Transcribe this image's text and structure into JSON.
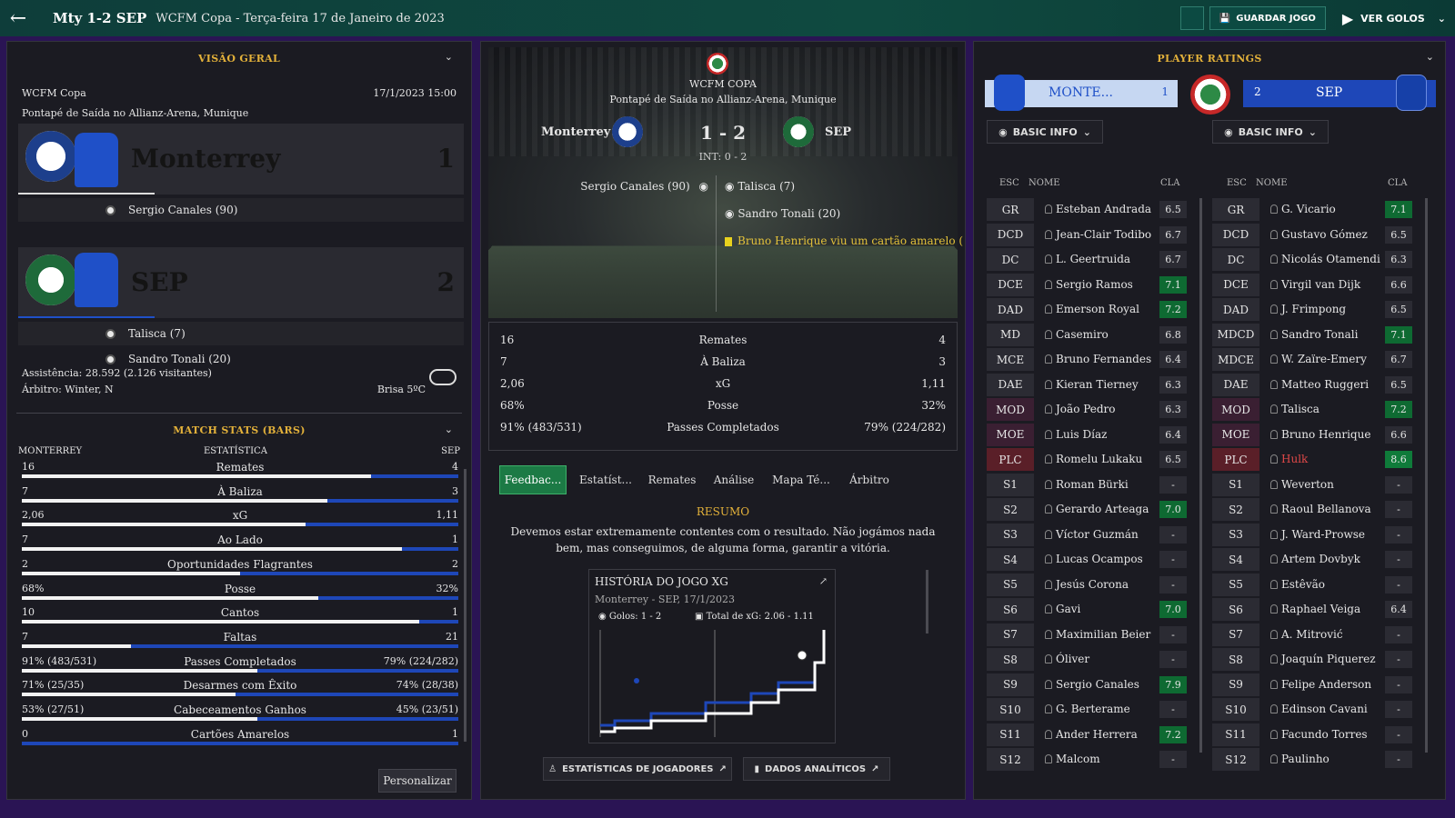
{
  "topbar": {
    "title": "Mty 1-2 SEP",
    "subtitle": "WCFM Copa - Terça-feira 17 de Janeiro de 2023",
    "save_label": "GUARDAR JOGO",
    "goals_label": "VER GOLOS"
  },
  "overview": {
    "title": "VISÃO GERAL",
    "competition": "WCFM Copa",
    "datetime": "17/1/2023 15:00",
    "kickoff": "Pontapé de Saída no Allianz-Arena, Munique",
    "home": {
      "name": "Monterrey",
      "score": "1",
      "scorers": [
        "Sergio Canales (90)"
      ]
    },
    "away": {
      "name": "SEP",
      "score": "2",
      "scorers": [
        "Talisca (7)",
        "Sandro Tonali (20)"
      ]
    },
    "attendance": "Assistência: 28.592 (2.126 visitantes)",
    "referee": "Árbitro: Winter, N",
    "weather": "Brisa 5ºC"
  },
  "match_stats": {
    "title": "MATCH STATS (BARS)",
    "home_label": "MONTERREY",
    "mid_label": "ESTATÍSTICA",
    "away_label": "SEP",
    "rows": [
      {
        "l": "16",
        "name": "Remates",
        "r": "4",
        "pct": 80
      },
      {
        "l": "7",
        "name": "À Baliza",
        "r": "3",
        "pct": 70
      },
      {
        "l": "2,06",
        "name": "xG",
        "r": "1,11",
        "pct": 65
      },
      {
        "l": "7",
        "name": "Ao Lado",
        "r": "1",
        "pct": 87
      },
      {
        "l": "2",
        "name": "Oportunidades Flagrantes",
        "r": "2",
        "pct": 50
      },
      {
        "l": "68%",
        "name": "Posse",
        "r": "32%",
        "pct": 68
      },
      {
        "l": "10",
        "name": "Cantos",
        "r": "1",
        "pct": 91
      },
      {
        "l": "7",
        "name": "Faltas",
        "r": "21",
        "pct": 25
      },
      {
        "l": "91% (483/531)",
        "name": "Passes Completados",
        "r": "79% (224/282)",
        "pct": 54
      },
      {
        "l": "71% (25/35)",
        "name": "Desarmes com Êxito",
        "r": "74% (28/38)",
        "pct": 49
      },
      {
        "l": "53% (27/51)",
        "name": "Cabeceamentos Ganhos",
        "r": "45% (23/51)",
        "pct": 54
      },
      {
        "l": "0",
        "name": "Cartões Amarelos",
        "r": "1",
        "pct": 0
      }
    ],
    "customize_label": "Personalizar"
  },
  "center": {
    "competition": "WCFM COPA",
    "kickoff": "Pontapé de Saída no Allianz-Arena, Munique",
    "home": "Monterrey",
    "away": "SEP",
    "score": "1 - 2",
    "ht": "INT: 0 - 2",
    "home_events": [
      "Sergio Canales (90)"
    ],
    "away_events": [
      "Talisca (7)",
      "Sandro Tonali (20)",
      "Bruno Henrique viu um cartão amarelo ("
    ],
    "stats": [
      {
        "l": "16",
        "name": "Remates",
        "r": "4"
      },
      {
        "l": "7",
        "name": "À Baliza",
        "r": "3"
      },
      {
        "l": "2,06",
        "name": "xG",
        "r": "1,11"
      },
      {
        "l": "68%",
        "name": "Posse",
        "r": "32%"
      },
      {
        "l": "91% (483/531)",
        "name": "Passes Completados",
        "r": "79% (224/282)"
      }
    ],
    "tabs": [
      "Feedbac...",
      "Estatíst...",
      "Remates",
      "Análise",
      "Mapa Té...",
      "Árbitro"
    ],
    "summary_title": "RESUMO",
    "summary": "Devemos estar extremamente contentes com o resultado. Não jogámos nada bem, mas conseguimos, de alguma forma, garantir a vitória.",
    "xg_title": "HISTÓRIA DO JOGO XG",
    "xg_sub": "Monterrey - SEP, 17/1/2023",
    "xg_goals": "Golos: 1 - 2",
    "xg_total": "Total de xG: 2.06 - 1.11",
    "btn_players": "ESTATÍSTICAS DE JOGADORES",
    "btn_analytics": "DADOS ANALÍTICOS"
  },
  "ratings": {
    "title": "PLAYER RATINGS",
    "home_short": "MONTE...",
    "home_score": "1",
    "away_short": "SEP",
    "away_score": "2",
    "info_label": "BASIC INFO",
    "col_pos": "ESC",
    "col_name": "NOME",
    "col_rating": "CLA",
    "home_players": [
      {
        "pos": "GR",
        "name": "Esteban Andrada",
        "rating": "6.5"
      },
      {
        "pos": "DCD",
        "name": "Jean-Clair Todibo",
        "rating": "6.7"
      },
      {
        "pos": "DC",
        "name": "L. Geertruida",
        "rating": "6.7"
      },
      {
        "pos": "DCE",
        "name": "Sergio Ramos",
        "rating": "7.1"
      },
      {
        "pos": "DAD",
        "name": "Emerson Royal",
        "rating": "7.2"
      },
      {
        "pos": "MD",
        "name": "Casemiro",
        "rating": "6.8"
      },
      {
        "pos": "MCE",
        "name": "Bruno Fernandes",
        "rating": "6.4"
      },
      {
        "pos": "DAE",
        "name": "Kieran Tierney",
        "rating": "6.3"
      },
      {
        "pos": "MOD",
        "name": "João Pedro",
        "rating": "6.3"
      },
      {
        "pos": "MOE",
        "name": "Luis Díaz",
        "rating": "6.4"
      },
      {
        "pos": "PLC",
        "name": "Romelu Lukaku",
        "rating": "6.5"
      },
      {
        "pos": "S1",
        "name": "Roman Bürki",
        "rating": "-"
      },
      {
        "pos": "S2",
        "name": "Gerardo Arteaga",
        "rating": "7.0"
      },
      {
        "pos": "S3",
        "name": "Víctor Guzmán",
        "rating": "-"
      },
      {
        "pos": "S4",
        "name": "Lucas Ocampos",
        "rating": "-"
      },
      {
        "pos": "S5",
        "name": "Jesús Corona",
        "rating": "-"
      },
      {
        "pos": "S6",
        "name": "Gavi",
        "rating": "7.0"
      },
      {
        "pos": "S7",
        "name": "Maximilian Beier",
        "rating": "-"
      },
      {
        "pos": "S8",
        "name": "Óliver",
        "rating": "-"
      },
      {
        "pos": "S9",
        "name": "Sergio Canales",
        "rating": "7.9"
      },
      {
        "pos": "S10",
        "name": "G. Berterame",
        "rating": "-"
      },
      {
        "pos": "S11",
        "name": "Ander Herrera",
        "rating": "7.2"
      },
      {
        "pos": "S12",
        "name": "Malcom",
        "rating": "-"
      }
    ],
    "away_players": [
      {
        "pos": "GR",
        "name": "G. Vicario",
        "rating": "7.1"
      },
      {
        "pos": "DCD",
        "name": "Gustavo Gómez",
        "rating": "6.5"
      },
      {
        "pos": "DC",
        "name": "Nicolás Otamendi",
        "rating": "6.3"
      },
      {
        "pos": "DCE",
        "name": "Virgil van Dijk",
        "rating": "6.6"
      },
      {
        "pos": "DAD",
        "name": "J. Frimpong",
        "rating": "6.5"
      },
      {
        "pos": "MDCD",
        "name": "Sandro Tonali",
        "rating": "7.1"
      },
      {
        "pos": "MDCE",
        "name": "W. Zaïre-Emery",
        "rating": "6.7"
      },
      {
        "pos": "DAE",
        "name": "Matteo Ruggeri",
        "rating": "6.5"
      },
      {
        "pos": "MOD",
        "name": "Talisca",
        "rating": "7.2"
      },
      {
        "pos": "MOE",
        "name": "Bruno Henrique",
        "rating": "6.6"
      },
      {
        "pos": "PLC",
        "name": "Hulk",
        "rating": "8.6"
      },
      {
        "pos": "S1",
        "name": "Weverton",
        "rating": "-"
      },
      {
        "pos": "S2",
        "name": "Raoul Bellanova",
        "rating": "-"
      },
      {
        "pos": "S3",
        "name": "J. Ward-Prowse",
        "rating": "-"
      },
      {
        "pos": "S4",
        "name": "Artem Dovbyk",
        "rating": "-"
      },
      {
        "pos": "S5",
        "name": "Estêvão",
        "rating": "-"
      },
      {
        "pos": "S6",
        "name": "Raphael Veiga",
        "rating": "6.4"
      },
      {
        "pos": "S7",
        "name": "A. Mitrović",
        "rating": "-"
      },
      {
        "pos": "S8",
        "name": "Joaquín Piquerez",
        "rating": "-"
      },
      {
        "pos": "S9",
        "name": "Felipe Anderson",
        "rating": "-"
      },
      {
        "pos": "S10",
        "name": "Edinson Cavani",
        "rating": "-"
      },
      {
        "pos": "S11",
        "name": "Facundo Torres",
        "rating": "-"
      },
      {
        "pos": "S12",
        "name": "Paulinho",
        "rating": "-"
      }
    ]
  },
  "colors": {
    "accent_gold": "#e3b13a",
    "home_blue": "#1f50c8",
    "rating_green": "#0e6a32",
    "red_pos": "#5a1f28"
  }
}
